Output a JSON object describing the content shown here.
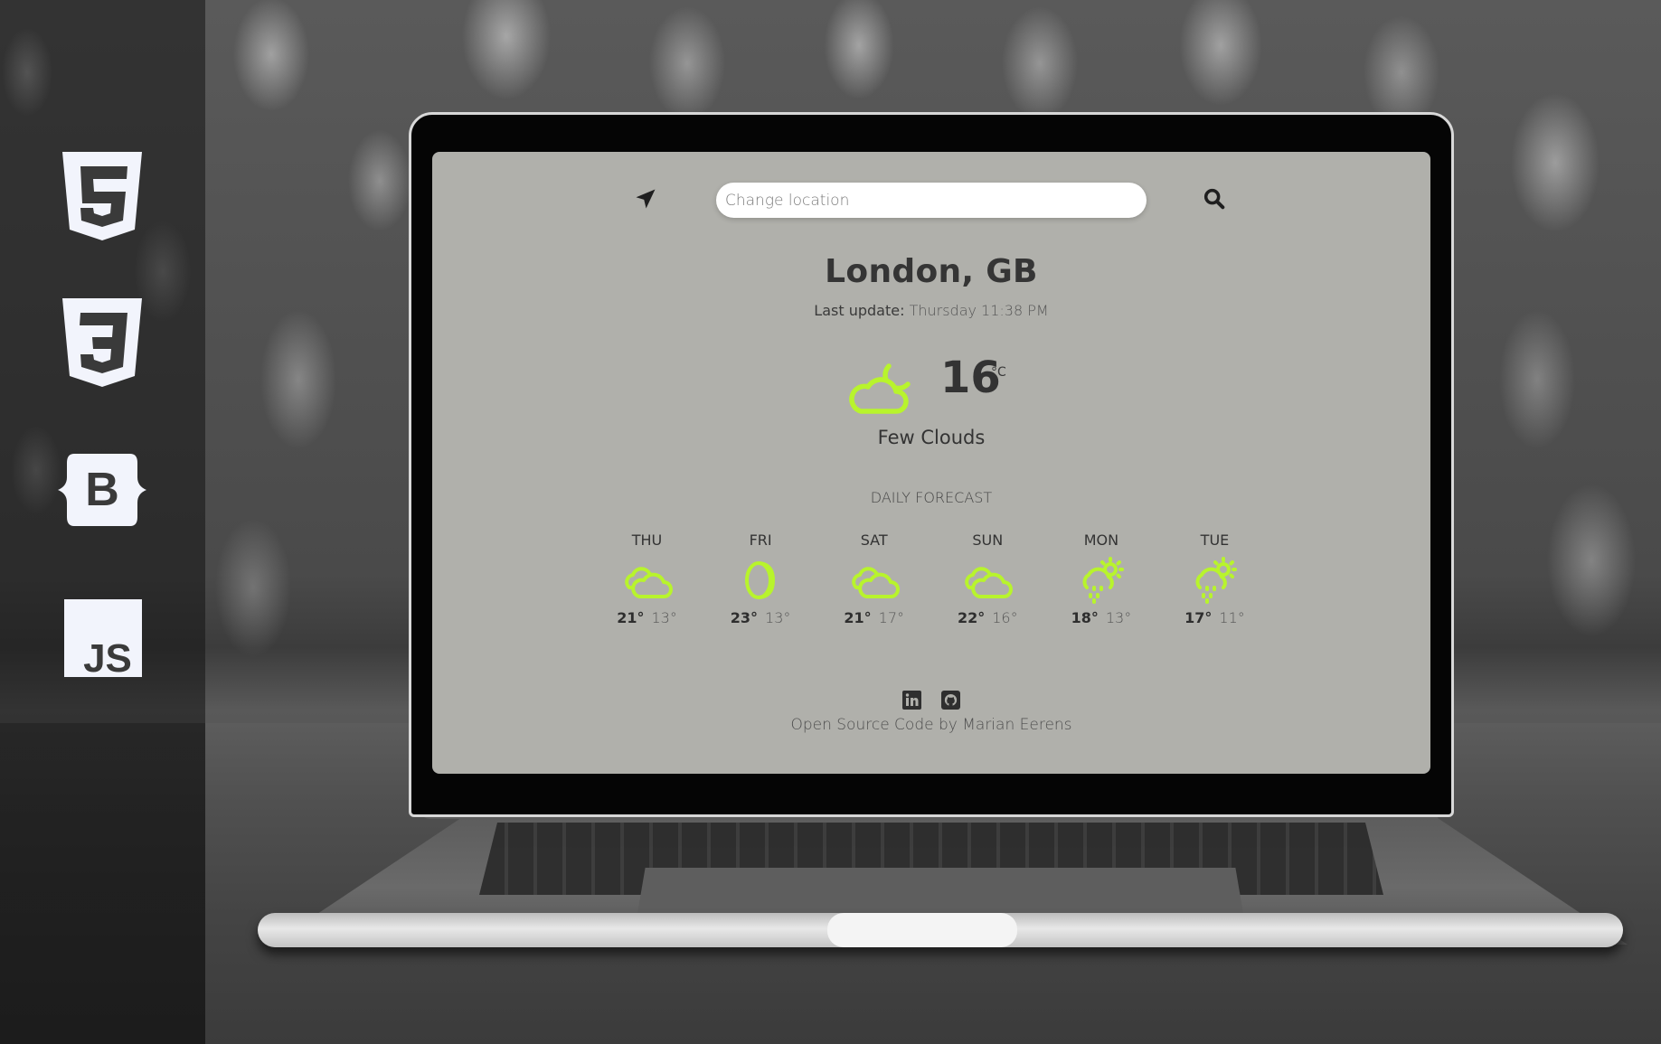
{
  "sidebar": {
    "tech_icons": [
      {
        "name": "html5-icon",
        "label": "5"
      },
      {
        "name": "css3-icon",
        "label": "3"
      },
      {
        "name": "bootstrap-icon",
        "label": "B"
      },
      {
        "name": "javascript-icon",
        "label": "JS"
      }
    ]
  },
  "app": {
    "search": {
      "placeholder": "Change location",
      "value": ""
    },
    "location_icon": "location-arrow-icon",
    "search_icon": "magnifier-icon",
    "city": "London, GB",
    "last_update_label": "Last update:",
    "last_update_value": "Thursday 11:38 PM",
    "current": {
      "icon": "few-clouds-night-icon",
      "temperature": "16",
      "unit": "°C",
      "description": "Few Clouds"
    },
    "forecast_title": "DAILY FORECAST",
    "forecast": [
      {
        "day": "THU",
        "icon": "clouds-icon",
        "high": "21°",
        "low": "13°"
      },
      {
        "day": "FRI",
        "icon": "clear-night-icon",
        "high": "23°",
        "low": "13°"
      },
      {
        "day": "SAT",
        "icon": "clouds-icon",
        "high": "21°",
        "low": "17°"
      },
      {
        "day": "SUN",
        "icon": "clouds-icon",
        "high": "22°",
        "low": "16°"
      },
      {
        "day": "MON",
        "icon": "rain-sun-icon",
        "high": "18°",
        "low": "13°"
      },
      {
        "day": "TUE",
        "icon": "rain-sun-icon",
        "high": "17°",
        "low": "11°"
      }
    ],
    "footer": {
      "socials": [
        "linkedin-icon",
        "github-icon"
      ],
      "text": "Open Source Code by Marian Eerens"
    }
  },
  "colors": {
    "accent": "#b8f42c",
    "screen_bg": "#b0b0ab",
    "text_dark": "#333333"
  }
}
